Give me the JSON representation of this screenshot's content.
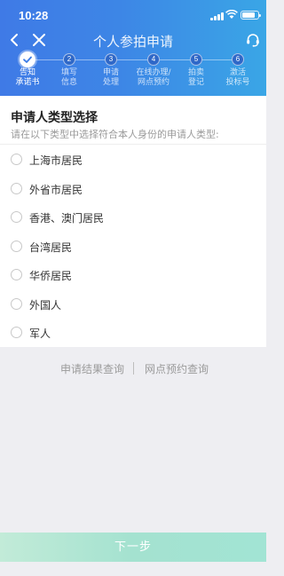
{
  "status_bar": {
    "time": "10:28",
    "battery_level": 0.85
  },
  "nav": {
    "title": "个人参拍申请"
  },
  "steps": [
    {
      "number": "",
      "label": "告知\n承诺书",
      "state": "completed"
    },
    {
      "number": "2",
      "label": "填写\n信息",
      "state": "pending"
    },
    {
      "number": "3",
      "label": "申请\n处理",
      "state": "pending"
    },
    {
      "number": "4",
      "label": "在线办理/\n网点预约",
      "state": "pending"
    },
    {
      "number": "5",
      "label": "拍卖\n登记",
      "state": "pending"
    },
    {
      "number": "6",
      "label": "激活\n投标号",
      "state": "pending"
    }
  ],
  "form": {
    "title": "申请人类型选择",
    "subtitle": "请在以下类型中选择符合本人身份的申请人类型:",
    "options": [
      {
        "label": "上海市居民",
        "selected": false
      },
      {
        "label": "外省市居民",
        "selected": false
      },
      {
        "label": "香港、澳门居民",
        "selected": false
      },
      {
        "label": "台湾居民",
        "selected": false
      },
      {
        "label": "华侨居民",
        "selected": false
      },
      {
        "label": "外国人",
        "selected": false
      },
      {
        "label": "军人",
        "selected": false
      }
    ]
  },
  "links": {
    "result_query": "申请结果查询",
    "outlet_query": "网点预约查询"
  },
  "footer": {
    "next_label": "下一步"
  },
  "colors": {
    "header_start": "#3f7ae6",
    "header_end": "#3aa6e6",
    "footer_button": "#a4e2d0"
  }
}
